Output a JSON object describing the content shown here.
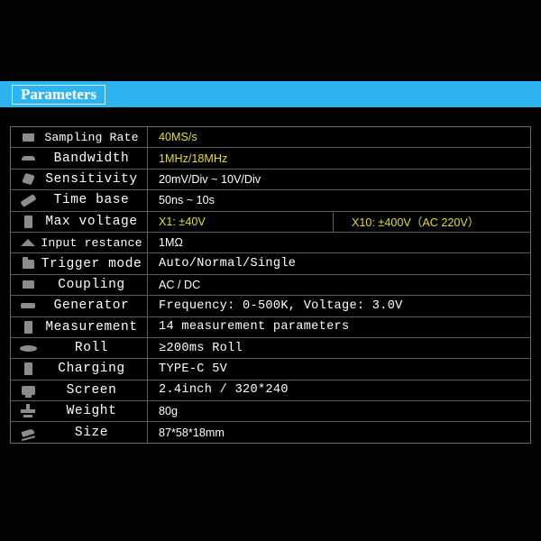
{
  "banner": {
    "title": "Parameters",
    "background_color": "#2cb3f0",
    "border_color": "#cfeeff"
  },
  "colors": {
    "page_background": "#030303",
    "accent_blue": "#2cb3f0",
    "highlight_yellow": "#e4dc34",
    "text_white": "#ffffff",
    "icon_grey": "#8c8c8c",
    "table_border": "#5a5a5a"
  },
  "table": {
    "rows": [
      {
        "icon": "chip-icon",
        "label": "Sampling Rate",
        "value": "40MS/s",
        "style": "yellow-sans"
      },
      {
        "icon": "wave-icon",
        "label": "Bandwidth",
        "value": "1MHz/18MHz",
        "style": "yellow-sans"
      },
      {
        "icon": "poly-icon",
        "label": "Sensitivity",
        "value": "20mV/Div ~ 10V/Div",
        "style": "white-sans"
      },
      {
        "icon": "slash-icon",
        "label": "Time base",
        "value": "50ns ~ 10s",
        "style": "white-sans"
      },
      {
        "icon": "bar-icon",
        "label": "Max voltage",
        "value": "X1: ±40V",
        "value2": "X10: ±400V（AC 220V）",
        "style": "yellow-sans-split"
      },
      {
        "icon": "hill-icon",
        "label": "Input restance",
        "value": "1MΩ",
        "style": "white-sans"
      },
      {
        "icon": "folder-icon",
        "label": "Trigger mode",
        "value": "Auto/Normal/Single",
        "style": "white-mono"
      },
      {
        "icon": "chip-icon",
        "label": "Coupling",
        "value": "AC / DC",
        "style": "white-sans"
      },
      {
        "icon": "dash-icon",
        "label": "Generator",
        "value": "Frequency: 0-500K, Voltage: 3.0V",
        "style": "white-mono"
      },
      {
        "icon": "bar-icon",
        "label": "Measurement",
        "value": "14 measurement parameters",
        "style": "white-mono"
      },
      {
        "icon": "ellipse-icon",
        "label": "Roll",
        "value": "≥200ms Roll",
        "style": "white-mono"
      },
      {
        "icon": "bar-icon",
        "label": "Charging",
        "value": "TYPE-C 5V",
        "style": "white-mono"
      },
      {
        "icon": "monitor-icon",
        "label": "Screen",
        "value": "2.4inch / 320*240",
        "style": "white-mono"
      },
      {
        "icon": "weight-icon",
        "label": "Weight",
        "value": "80g",
        "style": "white-sans"
      },
      {
        "icon": "ruler-icon",
        "label": "Size",
        "value": "87*58*18mm",
        "style": "white-sans"
      }
    ]
  }
}
